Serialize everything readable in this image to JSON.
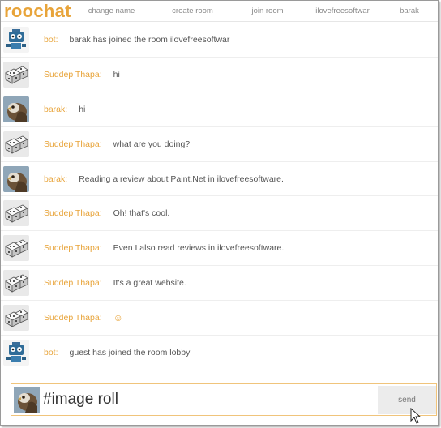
{
  "app": {
    "logo": "roochat"
  },
  "nav": {
    "items": [
      {
        "label": "change name"
      },
      {
        "label": "create room"
      },
      {
        "label": "join room"
      },
      {
        "label": "ilovefreesoftwar"
      },
      {
        "label": "barak"
      }
    ]
  },
  "messages": [
    {
      "sender": "bot:",
      "text": "barak has joined the room ilovefreesoftwar",
      "avatar": "robot-icon"
    },
    {
      "sender": "Suddep Thapa:",
      "text": "hi",
      "avatar": "dice-icon"
    },
    {
      "sender": "barak:",
      "text": "hi",
      "avatar": "bird-icon"
    },
    {
      "sender": "Suddep Thapa:",
      "text": "what are you doing?",
      "avatar": "dice-icon"
    },
    {
      "sender": "barak:",
      "text": "Reading a review about Paint.Net in ilovefreesoftware.",
      "avatar": "bird-icon"
    },
    {
      "sender": "Suddep Thapa:",
      "text": "Oh! that's cool.",
      "avatar": "dice-icon"
    },
    {
      "sender": "Suddep Thapa:",
      "text": "Even I also read reviews in ilovefreesoftware.",
      "avatar": "dice-icon"
    },
    {
      "sender": "Suddep Thapa:",
      "text": "It's a great website.",
      "avatar": "dice-icon"
    },
    {
      "sender": "Suddep Thapa:",
      "text": "☺",
      "avatar": "dice-icon"
    },
    {
      "sender": "bot:",
      "text": "guest has joined the room lobby",
      "avatar": "robot-icon"
    }
  ],
  "composer": {
    "value": "#image roll",
    "send_label": "send",
    "avatar": "bird-icon"
  },
  "colors": {
    "accent": "#e8a43a",
    "composer_border": "#f0c47b",
    "send_bg": "#ececec"
  }
}
